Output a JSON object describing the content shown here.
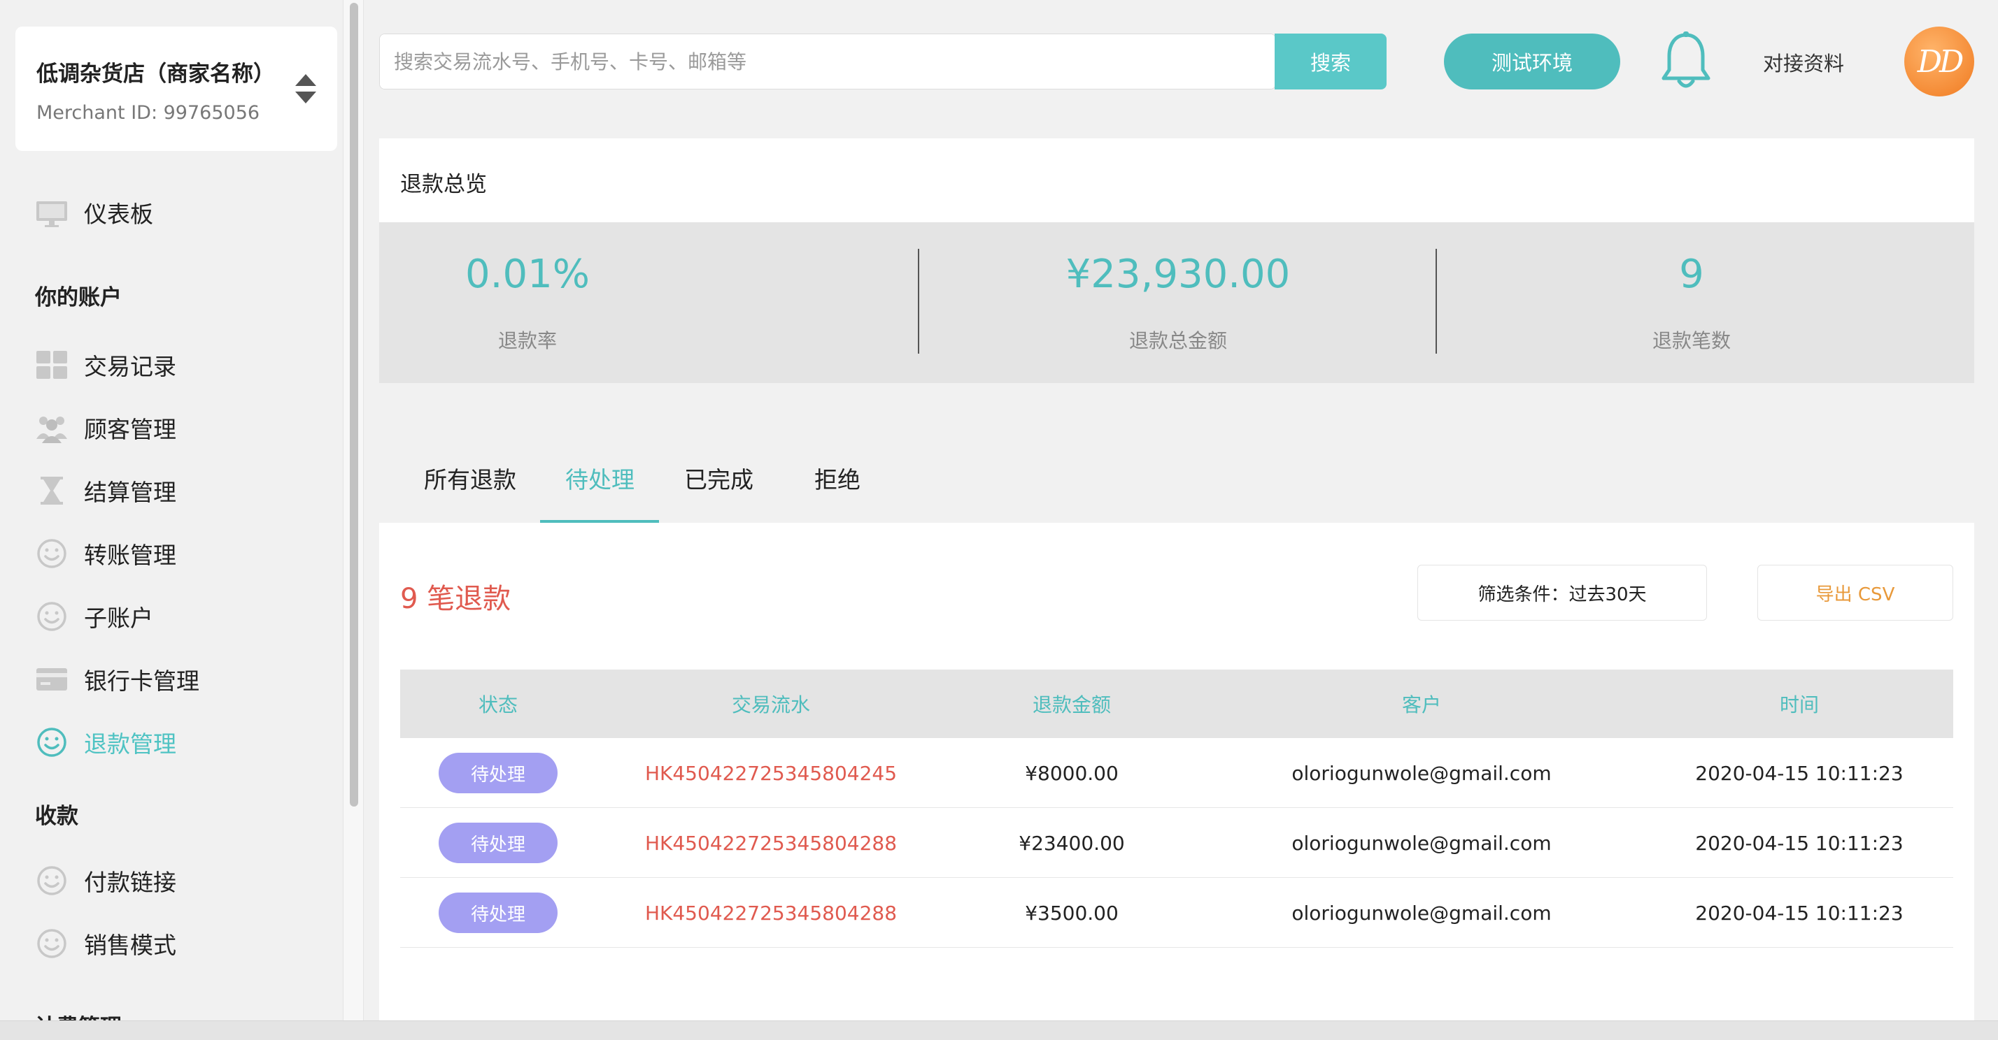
{
  "merchant": {
    "name": "低调杂货店（商家名称）",
    "id_text": "Merchant ID: 99765056"
  },
  "sidebar": {
    "dashboard": {
      "label": "仪表板",
      "icon": "monitor-icon"
    },
    "section_account": "你的账户",
    "items": [
      {
        "label": "交易记录",
        "icon": "grid-icon"
      },
      {
        "label": "顾客管理",
        "icon": "users-icon"
      },
      {
        "label": "结算管理",
        "icon": "hourglass-icon"
      },
      {
        "label": "转账管理",
        "icon": "smiley-icon"
      },
      {
        "label": "子账户",
        "icon": "smiley-icon"
      },
      {
        "label": "银行卡管理",
        "icon": "credit-card-icon"
      },
      {
        "label": "退款管理",
        "icon": "smiley-icon",
        "active": true
      }
    ],
    "section_collect": "收款",
    "collect_items": [
      {
        "label": "付款链接",
        "icon": "smiley-icon"
      },
      {
        "label": "销售模式",
        "icon": "smiley-icon"
      }
    ],
    "section_partial": "计费管理"
  },
  "header": {
    "search_placeholder": "搜索交易流水号、手机号、卡号、邮箱等",
    "search_button": "搜索",
    "env_button": "测试环境",
    "docs_link": "对接资料",
    "avatar_text": "DD"
  },
  "overview": {
    "title": "退款总览",
    "stats": [
      {
        "value": "0.01%",
        "label": "退款率"
      },
      {
        "value": "¥23,930.00",
        "label": "退款总金额"
      },
      {
        "value": "9",
        "label": "退款笔数"
      }
    ]
  },
  "tabs": [
    "所有退款",
    "待处理",
    "已完成",
    "拒绝"
  ],
  "active_tab": "待处理",
  "list": {
    "count_title": "9 笔退款",
    "filter_label": "筛选条件：过去30天",
    "export_label": "导出 CSV",
    "columns": [
      "状态",
      "交易流水",
      "退款金额",
      "客户",
      "时间"
    ],
    "rows": [
      {
        "status": "待处理",
        "txn": "HK450422725345804245",
        "amount": "¥8000.00",
        "customer": "oloriogunwole@gmail.com",
        "time": "2020-04-15 10:11:23"
      },
      {
        "status": "待处理",
        "txn": "HK450422725345804288",
        "amount": "¥23400.00",
        "customer": "oloriogunwole@gmail.com",
        "time": "2020-04-15 10:11:23"
      },
      {
        "status": "待处理",
        "txn": "HK450422725345804288",
        "amount": "¥3500.00",
        "customer": "oloriogunwole@gmail.com",
        "time": "2020-04-15 10:11:23"
      }
    ]
  },
  "colors": {
    "accent": "#4fbdbd",
    "danger": "#e05a4f",
    "badge": "#a39ff2",
    "export": "#e8993a",
    "avatar": "#f07a20"
  }
}
